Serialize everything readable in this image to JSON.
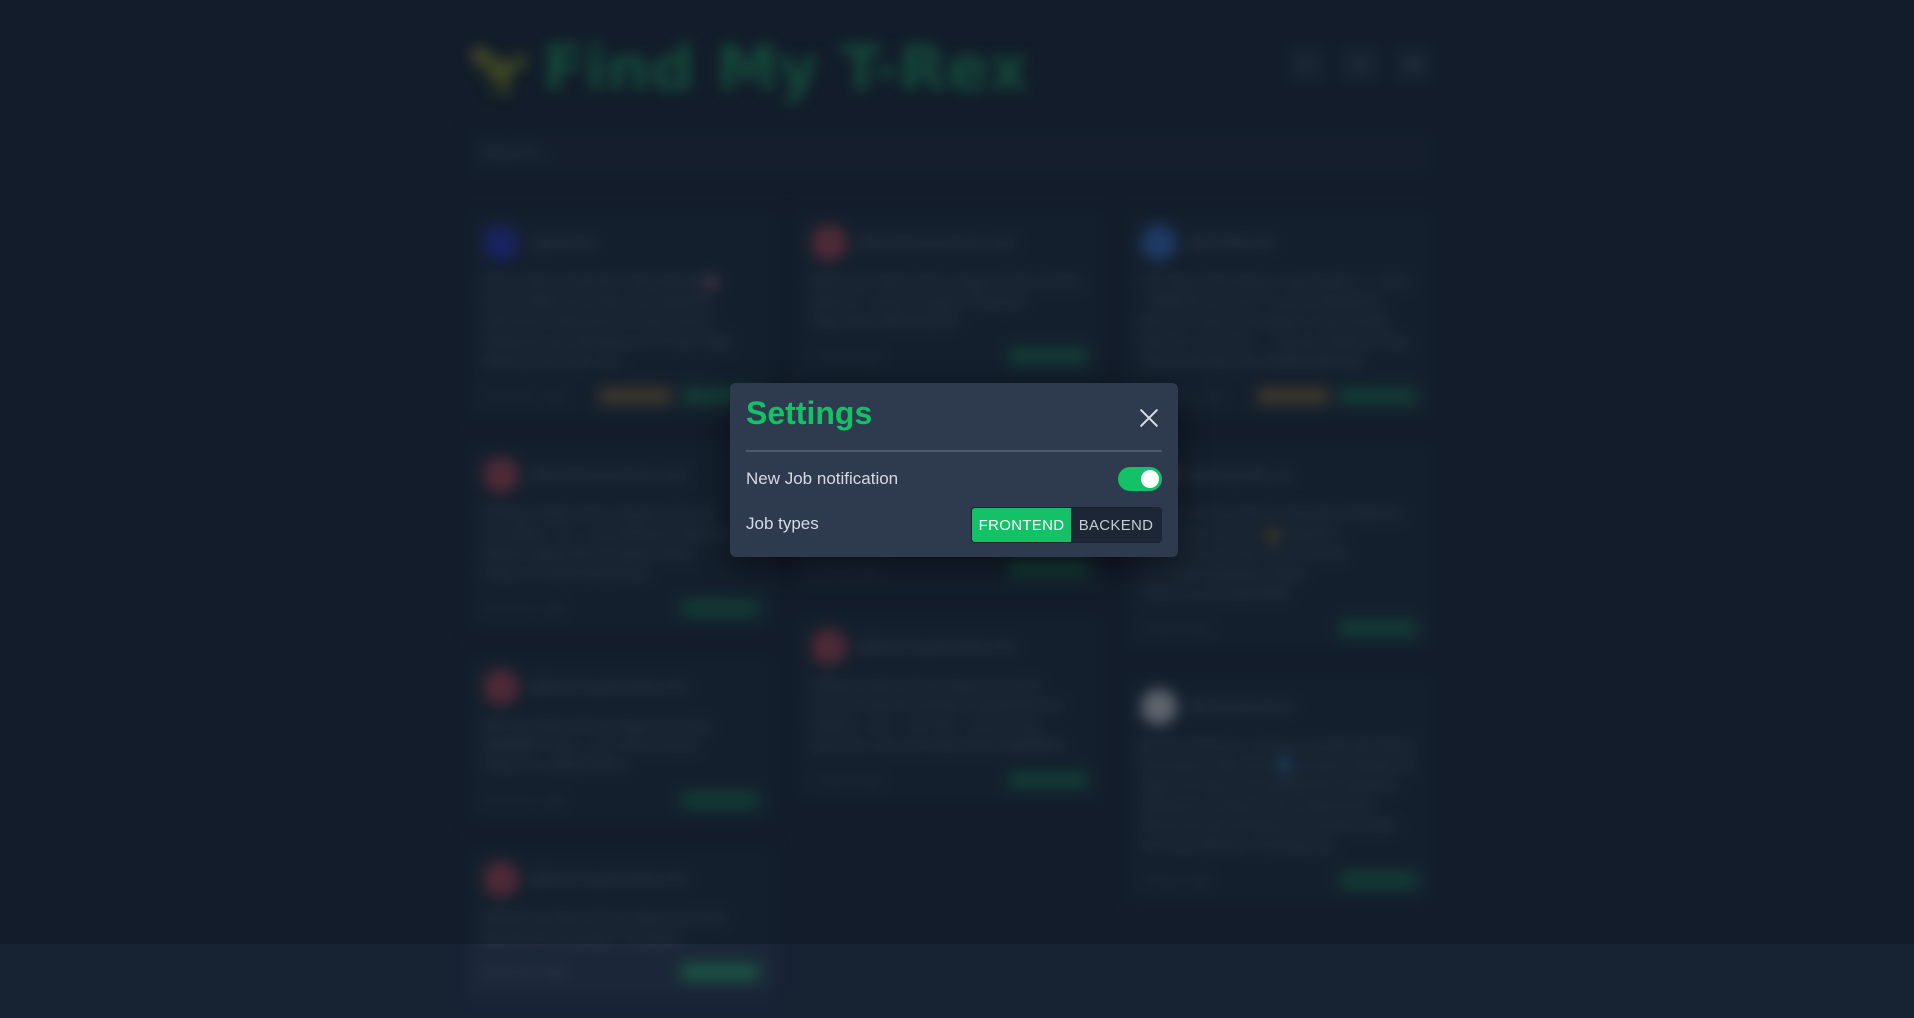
{
  "app": {
    "logo_icon": "🦖",
    "title": "Find My T-Rex",
    "header_icons": [
      "bell-icon",
      "mail-icon",
      "gear-icon"
    ],
    "search_placeholder": "Search..."
  },
  "feed": {
    "columns": [
      [
        {
          "avatar_color": "#2b36c9",
          "handle": "@jobmia",
          "text": "Hiring Senior Backend Developer 🇺🇸 Hiring #Remote https://t.co/jobrf0a #frontend #backend #node #react ##javascript #Freelancer #india #job #Hiring #Career #ux",
          "time": "8:15 a.m. ago",
          "tags": [
            "gold",
            "green"
          ]
        },
        {
          "avatar_color": "#c04a55",
          "handle": "@hiremaywmall.com",
          "text": "Portage State Hiring Opportunity @ Climalabs, LLC. Join Software Engineer - Mobile Applications Digital Roles https://t.co/RmHuHnDvak",
          "time": "8:15 a.m. ago",
          "tags": [
            "green"
          ]
        },
        {
          "avatar_color": "#c04a55",
          "handle": "@hiremaywmall.com",
          "text": "Moving State Hiring Opportunity @ BURNEXT Data, LLC: POS Analyst https://t.co/tMxhvffmd",
          "time": "8:15 a.m. ago",
          "tags": [
            "green"
          ]
        },
        {
          "avatar_color": "#c04a55",
          "handle": "@hiremaywmall.com",
          "text": "Marathon State Hiring Opportunity @ Backfire the Analytic Company",
          "time": "8:15 a.m. ago",
          "tags": [
            "green"
          ]
        }
      ],
      [
        {
          "avatar_color": "#c04a55",
          "handle": "@hiremaywmall.com",
          "text": "Merchant State Hiring Opportunity @ Hire Sphere | Senior Graphic Designer https://t.co/fKTGVQLNT",
          "time": "7 hours ago",
          "tags": [
            "green"
          ]
        },
        {
          "avatar_color": "#c04a55",
          "handle": "@hiremaywmall.com",
          "text": "Washington State Hiring Opportunity @ LAYMOND Install Ins Createsolution LLC. Administrative Assistant - Arlington, TX https://t.co/Brmty1ZJ",
          "time": "7 hours ago",
          "tags": [
            "green"
          ]
        },
        {
          "avatar_color": "#c04a55",
          "handle": "@hiremaywmall.com",
          "text": "Alfadse State Hiring Opportunity @ Human Heart Unlimited, Sweetlinkcom Hedonic arts - Art Vote, Community Samurai, Accurto https://t.co/HqM9G51",
          "time": "7 hours ago",
          "tags": [
            "green"
          ]
        }
      ],
      [
        {
          "avatar_color": "#3a7bd5",
          "handle": "@infoRemit",
          "text": "Full Stack Developer Lead (React, C, Vue) - REMOTE Contract at Vivid Networks: Brid Full Stack Developer Lead (Vue/Jn Remote Contract)... Anacap #Herntching #Hacajo https://t.co/S8fsesWvtKdi",
          "time": "8:15 a.m. ago",
          "tags": [
            "gold",
            "green"
          ]
        },
        {
          "avatar_color": "#c04a55",
          "handle": "@sirtgrabs_io",
          "text": "Name is hiring Senior Software Engineer 🏃 #remote #ruth 💪 #python #javascript #ruby #rust #react #softwareengineer #jobs https://t.co/cmJeUtHNn",
          "time": "9 hours ago",
          "tags": [
            "green"
          ]
        },
        {
          "avatar_color": "#e8ecef",
          "handle": "@vokisbearch",
          "text": "▶ Indi Institute is hiring a JavaScript React Developer (Remote) 🌎 Jonastis Stated US Apply ⬇ https://t.co/gaS9mfhq #jobinfo #jobsearch #Dutchness #pertanent #hirenaming #freelanced #softcmedar #hiring #Worker #softwaring",
          "time": "9 hours ago",
          "tags": [
            "green"
          ]
        }
      ]
    ]
  },
  "settings": {
    "title": "Settings",
    "close_icon": "close-icon",
    "notification_label": "New Job notification",
    "notification_enabled": true,
    "job_types_label": "Job types",
    "job_types": [
      {
        "label": "FRONTEND",
        "selected": true
      },
      {
        "label": "BACKEND",
        "selected": false
      }
    ],
    "accent_color": "#13c167"
  }
}
